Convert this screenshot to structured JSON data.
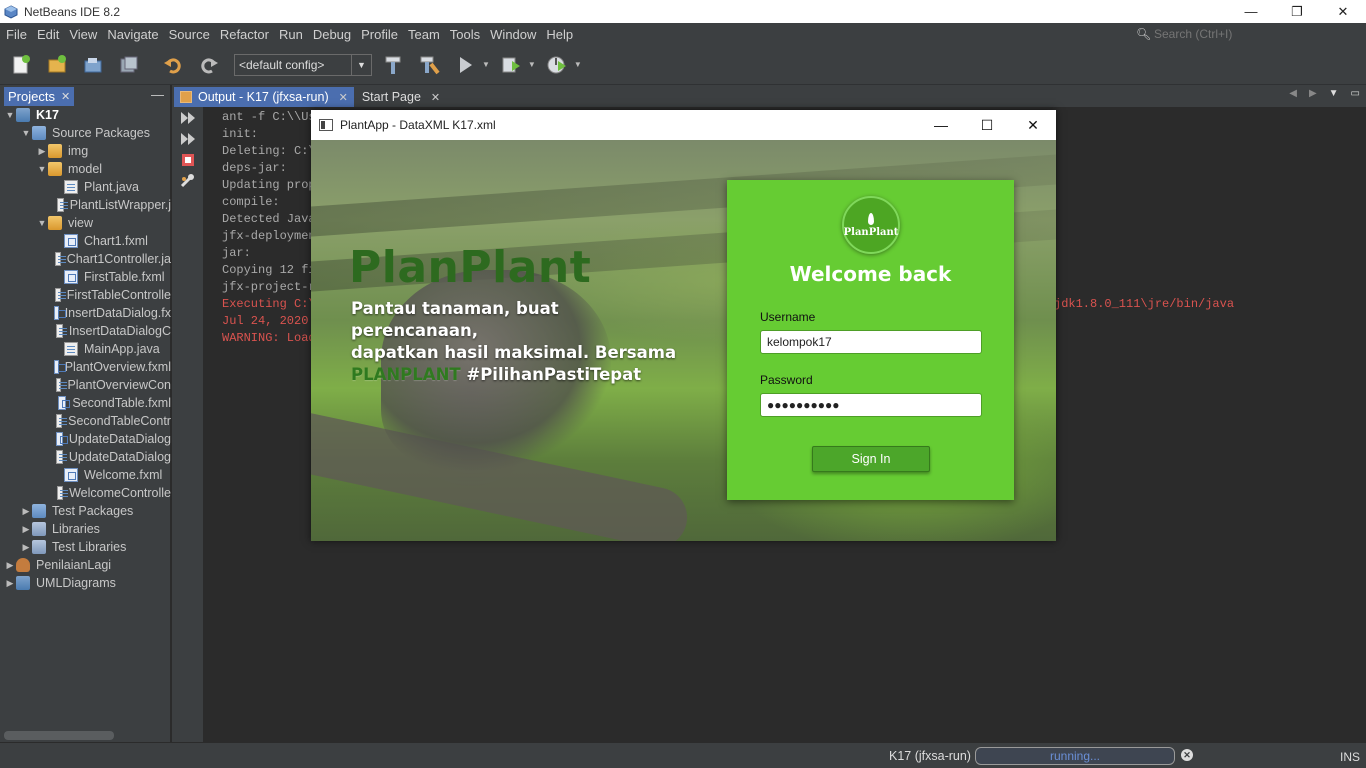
{
  "ide": {
    "title": "NetBeans IDE 8.2",
    "menu": [
      "File",
      "Edit",
      "View",
      "Navigate",
      "Source",
      "Refactor",
      "Run",
      "Debug",
      "Profile",
      "Team",
      "Tools",
      "Window",
      "Help"
    ],
    "search_placeholder": "Search (Ctrl+I)",
    "config_value": "<default config>"
  },
  "projects_panel": {
    "tab_label": "Projects",
    "tree": [
      {
        "label": "K17",
        "depth": 0,
        "arrow": "▼",
        "icon": "project-icon",
        "bold": true
      },
      {
        "label": "Source Packages",
        "depth": 1,
        "arrow": "▼",
        "icon": "source-packages-icon"
      },
      {
        "label": "img",
        "depth": 2,
        "arrow": "▶",
        "icon": "package-icon"
      },
      {
        "label": "model",
        "depth": 2,
        "arrow": "▼",
        "icon": "package-icon"
      },
      {
        "label": "Plant.java",
        "depth": 3,
        "arrow": "",
        "icon": "java-file-icon"
      },
      {
        "label": "PlantListWrapper.j",
        "depth": 3,
        "arrow": "",
        "icon": "java-file-icon"
      },
      {
        "label": "view",
        "depth": 2,
        "arrow": "▼",
        "icon": "package-icon"
      },
      {
        "label": "Chart1.fxml",
        "depth": 3,
        "arrow": "",
        "icon": "fxml-file-icon"
      },
      {
        "label": "Chart1Controller.ja",
        "depth": 3,
        "arrow": "",
        "icon": "java-file-icon"
      },
      {
        "label": "FirstTable.fxml",
        "depth": 3,
        "arrow": "",
        "icon": "fxml-file-icon"
      },
      {
        "label": "FirstTableControlle",
        "depth": 3,
        "arrow": "",
        "icon": "java-file-icon"
      },
      {
        "label": "InsertDataDialog.fx",
        "depth": 3,
        "arrow": "",
        "icon": "fxml-file-icon"
      },
      {
        "label": "InsertDataDialogC",
        "depth": 3,
        "arrow": "",
        "icon": "java-file-icon"
      },
      {
        "label": "MainApp.java",
        "depth": 3,
        "arrow": "",
        "icon": "java-file-icon"
      },
      {
        "label": "PlantOverview.fxml",
        "depth": 3,
        "arrow": "",
        "icon": "fxml-file-icon"
      },
      {
        "label": "PlantOverviewCon",
        "depth": 3,
        "arrow": "",
        "icon": "java-file-icon"
      },
      {
        "label": "SecondTable.fxml",
        "depth": 3,
        "arrow": "",
        "icon": "fxml-file-icon"
      },
      {
        "label": "SecondTableContr",
        "depth": 3,
        "arrow": "",
        "icon": "java-file-icon"
      },
      {
        "label": "UpdateDataDialog",
        "depth": 3,
        "arrow": "",
        "icon": "fxml-file-icon"
      },
      {
        "label": "UpdateDataDialog",
        "depth": 3,
        "arrow": "",
        "icon": "java-file-icon"
      },
      {
        "label": "Welcome.fxml",
        "depth": 3,
        "arrow": "",
        "icon": "fxml-file-icon"
      },
      {
        "label": "WelcomeControlle",
        "depth": 3,
        "arrow": "",
        "icon": "java-file-icon"
      },
      {
        "label": "Test Packages",
        "depth": 1,
        "arrow": "▶",
        "icon": "test-packages-icon"
      },
      {
        "label": "Libraries",
        "depth": 1,
        "arrow": "▶",
        "icon": "libraries-icon"
      },
      {
        "label": "Test Libraries",
        "depth": 1,
        "arrow": "▶",
        "icon": "libraries-icon"
      },
      {
        "label": "PenilaianLagi",
        "depth": 0,
        "arrow": "▶",
        "icon": "coffee-project-icon"
      },
      {
        "label": "UMLDiagrams",
        "depth": 0,
        "arrow": "▶",
        "icon": "project-icon"
      }
    ]
  },
  "editor": {
    "tabs": [
      {
        "label": "Output - K17 (jfxsa-run)",
        "active": true
      },
      {
        "label": "Start Page",
        "active": false
      }
    ],
    "console_lines": [
      {
        "text": "ant -f C:\\\\Us",
        "err": false
      },
      {
        "text": "init:",
        "err": false
      },
      {
        "text": "Deleting: C:\\",
        "err": false
      },
      {
        "text": "deps-jar:",
        "err": false
      },
      {
        "text": "Updating prop",
        "err": false
      },
      {
        "text": "compile:",
        "err": false
      },
      {
        "text": "Detected Java",
        "err": false
      },
      {
        "text": "jfx-deploymen",
        "err": false
      },
      {
        "text": "jar:",
        "err": false
      },
      {
        "text": "Copying 12 fi",
        "err": false
      },
      {
        "text": "jfx-project-r",
        "err": false
      },
      {
        "text": "Executing C:\\",
        "err": true
      },
      {
        "text": "Jul 24, 2020",
        "err": true
      },
      {
        "text": "WARNING: Load",
        "err": true
      }
    ],
    "console_tail": "jdk1.8.0_111\\jre/bin/java"
  },
  "status": {
    "task": "K17 (jfxsa-run)",
    "progress_text": "running...",
    "mode": "INS"
  },
  "plantapp": {
    "window_title": "PlantApp - DataXML K17.xml",
    "brand": "PlanPlant",
    "tagline_line1": "Pantau tanaman, buat perencanaan,",
    "tagline_line2": "dapatkan hasil maksimal. Bersama",
    "tagline_highlight": "PLANPLANT",
    "tagline_hashtag": " #PilihanPastiTepat",
    "logo_text": "PlanPlant",
    "welcome": "Welcome back",
    "username_label": "Username",
    "username_value": "kelompok17",
    "password_label": "Password",
    "password_value": "●●●●●●●●●●",
    "signin_label": "Sign In"
  }
}
